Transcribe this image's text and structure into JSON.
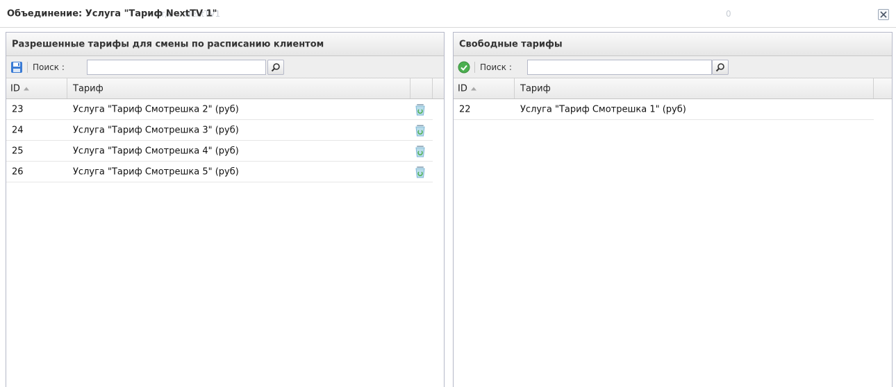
{
  "window": {
    "title": "Объединение: Услуга \"Тариф NextTV 1\"",
    "ghost_text": "ит/с + NextTV1",
    "ghost_zero": "0"
  },
  "left_panel": {
    "title": "Разрешенные тарифы для смены по расписанию клиентом",
    "search_label": "Поиск :",
    "search_value": "",
    "columns": {
      "id": "ID",
      "name": "Тариф"
    },
    "rows": [
      {
        "id": "23",
        "name": "Услуга \"Тариф Смотрешка 2\" (руб)"
      },
      {
        "id": "24",
        "name": "Услуга \"Тариф Смотрешка 3\" (руб)"
      },
      {
        "id": "25",
        "name": "Услуга \"Тариф Смотрешка 4\" (руб)"
      },
      {
        "id": "26",
        "name": "Услуга \"Тариф Смотрешка 5\" (руб)"
      }
    ]
  },
  "right_panel": {
    "title": "Свободные тарифы",
    "search_label": "Поиск :",
    "search_value": "",
    "columns": {
      "id": "ID",
      "name": "Тариф"
    },
    "rows": [
      {
        "id": "22",
        "name": "Услуга \"Тариф Смотрешка 1\" (руб)"
      }
    ]
  },
  "icons": {
    "save": "save-icon",
    "apply": "check-circle-icon",
    "search": "search-icon",
    "delete": "trash-icon",
    "close": "close-icon"
  },
  "colors": {
    "save_icon": "#3a7bd5",
    "apply_icon": "#4caf50",
    "trash_icon": "#7fb8d6",
    "border": "#b5b8c8"
  }
}
